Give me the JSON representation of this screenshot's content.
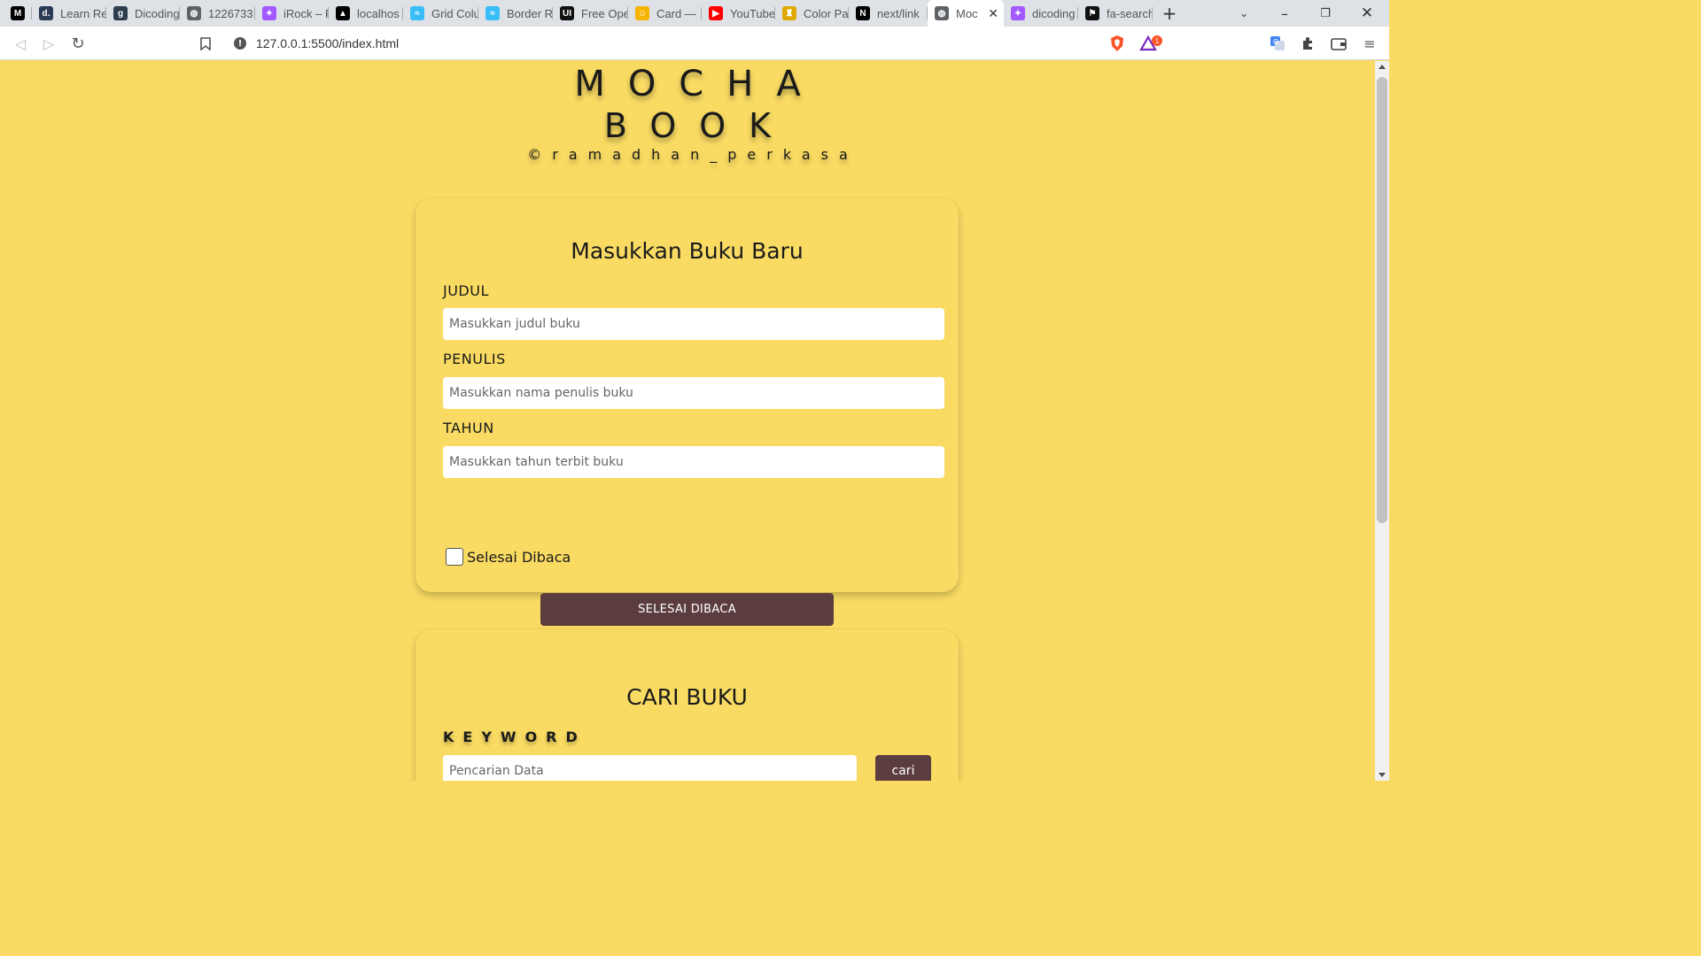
{
  "browser": {
    "tabs": [
      {
        "title": "",
        "favicon": "M",
        "favicon_color": "#000000",
        "active": false
      },
      {
        "title": "Learn Re",
        "favicon": "d.",
        "favicon_color": "#2b3a55",
        "active": false
      },
      {
        "title": "Dicoding",
        "favicon": "g",
        "favicon_color": "#2d3e50",
        "active": false
      },
      {
        "title": "1226733",
        "favicon": "◍",
        "favicon_color": "#5f6368",
        "active": false
      },
      {
        "title": "iRock – F",
        "favicon": "✦",
        "favicon_color": "#a259ff",
        "active": false
      },
      {
        "title": "localhos",
        "favicon": "▲",
        "favicon_color": "#000000",
        "active": false
      },
      {
        "title": "Grid Colu",
        "favicon": "≈",
        "favicon_color": "#38bdf8",
        "active": false
      },
      {
        "title": "Border R",
        "favicon": "≈",
        "favicon_color": "#38bdf8",
        "active": false
      },
      {
        "title": "Free Ope",
        "favicon": "UI",
        "favicon_color": "#111111",
        "active": false
      },
      {
        "title": "Card —",
        "favicon": "☺",
        "favicon_color": "#f5b400",
        "active": false
      },
      {
        "title": "YouTube",
        "favicon": "▶",
        "favicon_color": "#ff0000",
        "active": false
      },
      {
        "title": "Color Pa",
        "favicon": "♜",
        "favicon_color": "#e0a800",
        "active": false
      },
      {
        "title": "next/link",
        "favicon": "N",
        "favicon_color": "#000000",
        "active": false
      },
      {
        "title": "Moc",
        "favicon": "◍",
        "favicon_color": "#5f6368",
        "active": true
      },
      {
        "title": "dicoding",
        "favicon": "✦",
        "favicon_color": "#a259ff",
        "active": false
      },
      {
        "title": "fa-search",
        "favicon": "⚑",
        "favicon_color": "#111111",
        "active": false
      }
    ],
    "url": "127.0.0.1:5500/index.html",
    "brave_badge": "1"
  },
  "header": {
    "brand_line1": "MOCHA",
    "brand_line2": "BOOK",
    "credit": "©ramadhan_perkasa"
  },
  "form": {
    "title": "Masukkan Buku Baru",
    "title_label": "JUDUL",
    "title_placeholder": "Masukkan judul buku",
    "author_label": "PENULIS",
    "author_placeholder": "Masukkan nama penulis buku",
    "year_label": "TAHUN",
    "year_placeholder": "Masukkan tahun terbit buku",
    "checkbox_label": "Selesai Dibaca",
    "submit_label": "SELESAI DIBACA"
  },
  "search": {
    "title": "CARI BUKU",
    "keyword_label": "KEYWORD",
    "placeholder": "Pencarian Data",
    "button_label": "cari"
  },
  "colors": {
    "page_bg": "#f9db63",
    "button_bg": "#5c3d3f"
  }
}
